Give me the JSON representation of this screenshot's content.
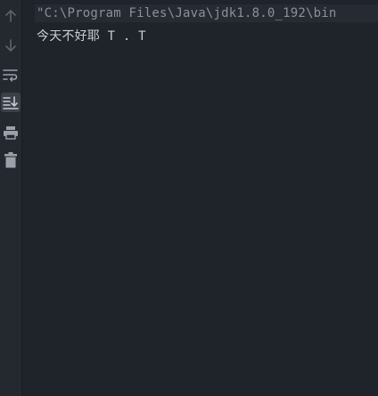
{
  "toolbar": {
    "buttons": [
      {
        "icon": "arrow-up-icon",
        "name": "scroll-up-button",
        "active": false
      },
      {
        "icon": "arrow-down-icon",
        "name": "scroll-down-button",
        "active": false
      },
      {
        "icon": "soft-wrap-icon",
        "name": "soft-wrap-button",
        "active": false
      },
      {
        "icon": "scroll-to-end-icon",
        "name": "scroll-to-end-button",
        "active": true
      },
      {
        "icon": "print-icon",
        "name": "print-button",
        "active": false
      },
      {
        "icon": "trash-icon",
        "name": "clear-all-button",
        "active": false
      }
    ]
  },
  "console": {
    "command_line": "\"C:\\Program Files\\Java\\jdk1.8.0_192\\bin",
    "output_line": "今天不好耶 T . T"
  },
  "colors": {
    "background": "#1f232a",
    "toolbar_bg": "#24282f",
    "command_text": "#8a9099",
    "output_text": "#c9cfd7",
    "icon": "#9aa1ab"
  }
}
